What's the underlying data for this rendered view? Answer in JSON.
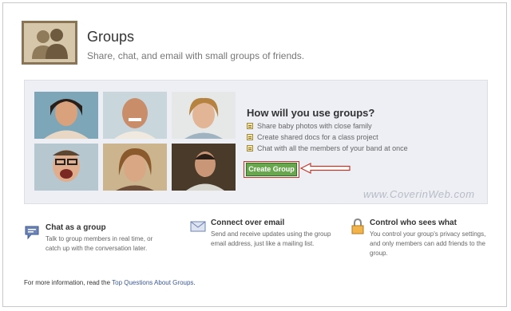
{
  "header": {
    "title": "Groups",
    "subtitle": "Share, chat, and email with small groups of friends."
  },
  "panel": {
    "heading": "How will you use groups?",
    "uses": [
      "Share baby photos with close family",
      "Create shared docs for a class project",
      "Chat with all the members of your band at once"
    ],
    "button_label": "Create Group",
    "watermark": "www.CoverinWeb.com"
  },
  "features": [
    {
      "title": "Chat as a group",
      "desc": "Talk to group members in real time, or catch up with the conversation later.",
      "icon": "chat-bubble-icon"
    },
    {
      "title": "Connect over email",
      "desc": "Send and receive updates using the group email address, just like a mailing list.",
      "icon": "envelope-icon"
    },
    {
      "title": "Control who sees what",
      "desc": "You control your group's privacy settings, and only members can add friends to the group.",
      "icon": "lock-icon"
    }
  ],
  "footer": {
    "prefix": "For more information, read the ",
    "link": "Top Questions About Groups",
    "suffix": "."
  },
  "colors": {
    "accent": "#3b5998",
    "button": "#69a74e",
    "highlight": "#c0392b"
  }
}
